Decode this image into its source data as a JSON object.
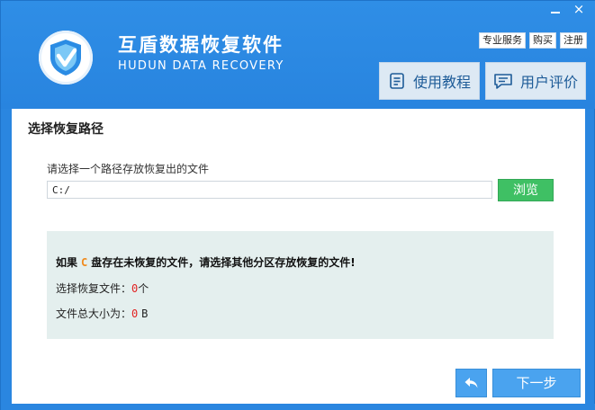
{
  "window": {
    "minimize_label": "",
    "close_label": "×"
  },
  "header": {
    "title": "互盾数据恢复软件",
    "subtitle": "HUDUN DATA RECOVERY",
    "links": [
      "专业服务",
      "购买",
      "注册"
    ],
    "tutorial_label": "使用教程",
    "review_label": "用户评价"
  },
  "main": {
    "section_title": "选择恢复路径",
    "path_label": "请选择一个路径存放恢复出的文件",
    "path_value": "C:/",
    "browse_label": "浏览",
    "info": {
      "warn_prefix": "如果",
      "drive_letter": "C",
      "warn_suffix": "盘存在未恢复的文件，请选择其他分区存放恢复的文件!",
      "files_label": "选择恢复文件：",
      "files_count": "0",
      "files_unit": "个",
      "size_label": "文件总大小为：",
      "size_value": "0",
      "size_unit": "B"
    },
    "next_label": "下一步"
  },
  "colors": {
    "header_blue": "#2a86e0",
    "accent_green": "#3fc064",
    "button_blue": "#4aa3ef",
    "info_bg": "#e4efee",
    "highlight_orange": "#f08a1c",
    "count_red": "#e22222"
  },
  "icons": {
    "logo": "shield-check-icon",
    "tutorial": "document-list-icon",
    "review": "chat-bubble-icon",
    "back": "arrow-back-icon"
  }
}
